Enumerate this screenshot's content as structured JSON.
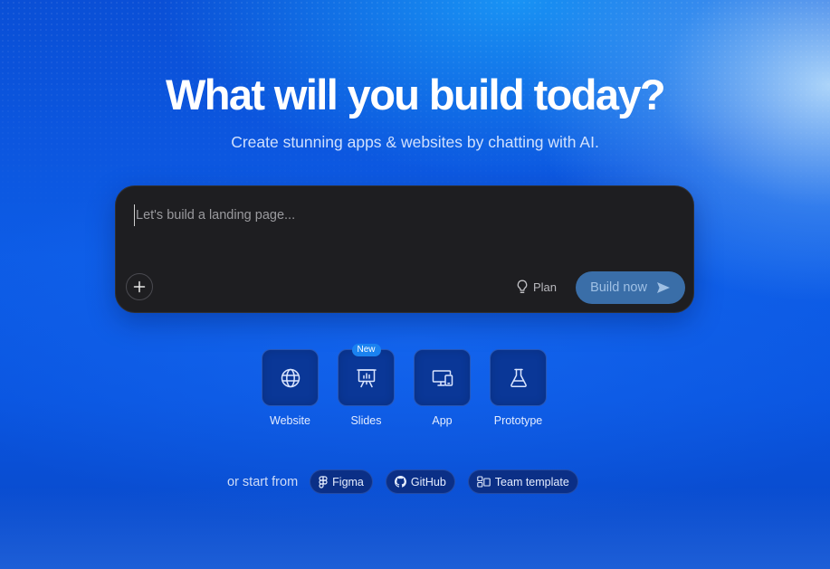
{
  "hero": {
    "title": "What will you build today?",
    "subtitle": "Create stunning apps & websites by chatting with AI."
  },
  "prompt": {
    "placeholder": "Let's build a landing page...",
    "value": "",
    "add_icon": "plus-icon",
    "plan_label": "Plan",
    "plan_icon": "lightbulb-icon",
    "build_label": "Build now",
    "build_icon": "send-icon"
  },
  "project_types": [
    {
      "label": "Website",
      "icon": "globe-icon",
      "badge": ""
    },
    {
      "label": "Slides",
      "icon": "presentation-icon",
      "badge": "New"
    },
    {
      "label": "App",
      "icon": "devices-icon",
      "badge": ""
    },
    {
      "label": "Prototype",
      "icon": "flask-icon",
      "badge": ""
    }
  ],
  "start_from": {
    "label": "or start from",
    "options": [
      {
        "label": "Figma",
        "icon": "figma-icon"
      },
      {
        "label": "GitHub",
        "icon": "github-icon"
      },
      {
        "label": "Team template",
        "icon": "template-icon"
      }
    ]
  },
  "colors": {
    "accent": "#1a82f0",
    "card_bg": "#1e1e21",
    "build_button": "#3a6ea8",
    "tile_bg": "#0a3797"
  }
}
